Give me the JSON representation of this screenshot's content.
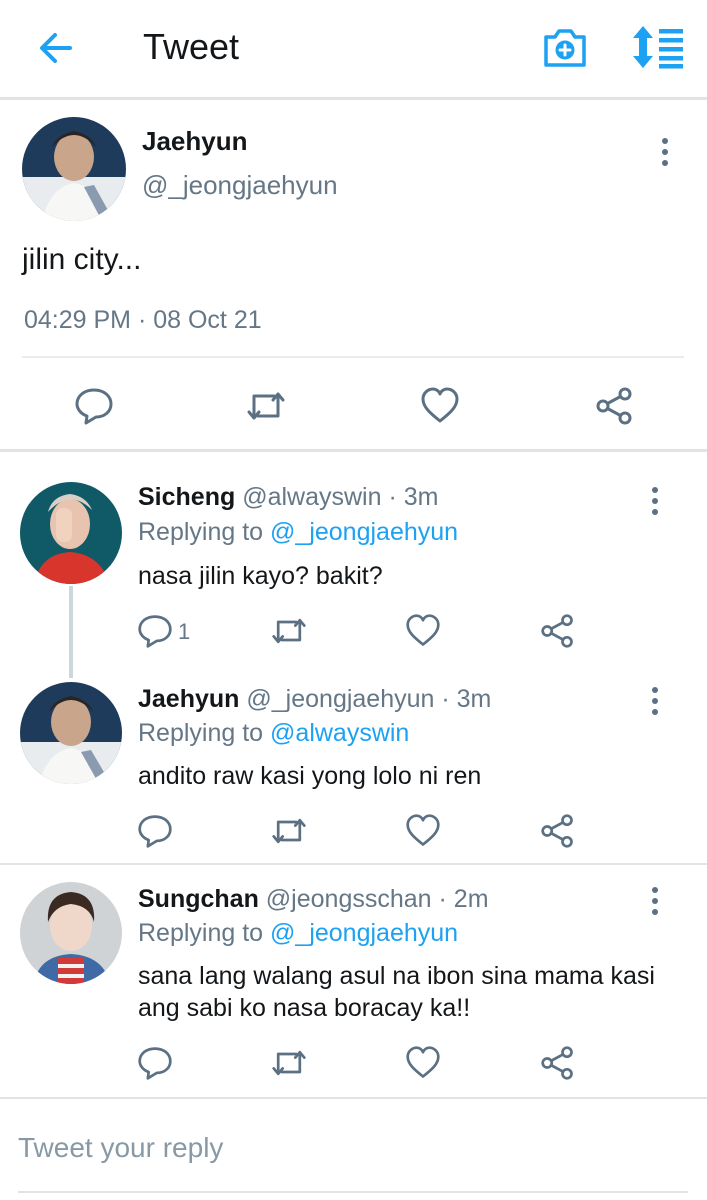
{
  "header": {
    "title": "Tweet",
    "back_icon": "arrow-left-icon",
    "camera_icon": "camera-plus-icon",
    "sort_icon": "sort-icon",
    "accent": "#1da1f2"
  },
  "main_tweet": {
    "name": "Jaehyun",
    "handle": "@_jeongjaehyun",
    "text": "jilin city...",
    "timestamp": "04:29 PM · 08 Oct 21"
  },
  "replies": [
    {
      "name": "Sicheng",
      "handle": "@alwayswin",
      "time": "3m",
      "replying_label": "Replying to",
      "replying_to": "@_jeongjaehyun",
      "text": "nasa jilin kayo? bakit?",
      "reply_count": "1"
    },
    {
      "name": "Jaehyun",
      "handle": "@_jeongjaehyun",
      "time": "3m",
      "replying_label": "Replying to",
      "replying_to": "@alwayswin",
      "text": "andito raw kasi yong lolo ni ren",
      "reply_count": ""
    },
    {
      "name": "Sungchan",
      "handle": "@jeongsschan",
      "time": "2m",
      "replying_label": "Replying to",
      "replying_to": "@_jeongjaehyun",
      "text": "sana lang walang asul na ibon sina mama kasi ang sabi ko nasa boracay ka!!",
      "reply_count": ""
    }
  ],
  "compose": {
    "placeholder": "Tweet your reply"
  },
  "colors": {
    "blue": "#1da1f2",
    "gray": "#657786",
    "icon_gray": "#5b7083",
    "divider": "#e1e3e6"
  }
}
